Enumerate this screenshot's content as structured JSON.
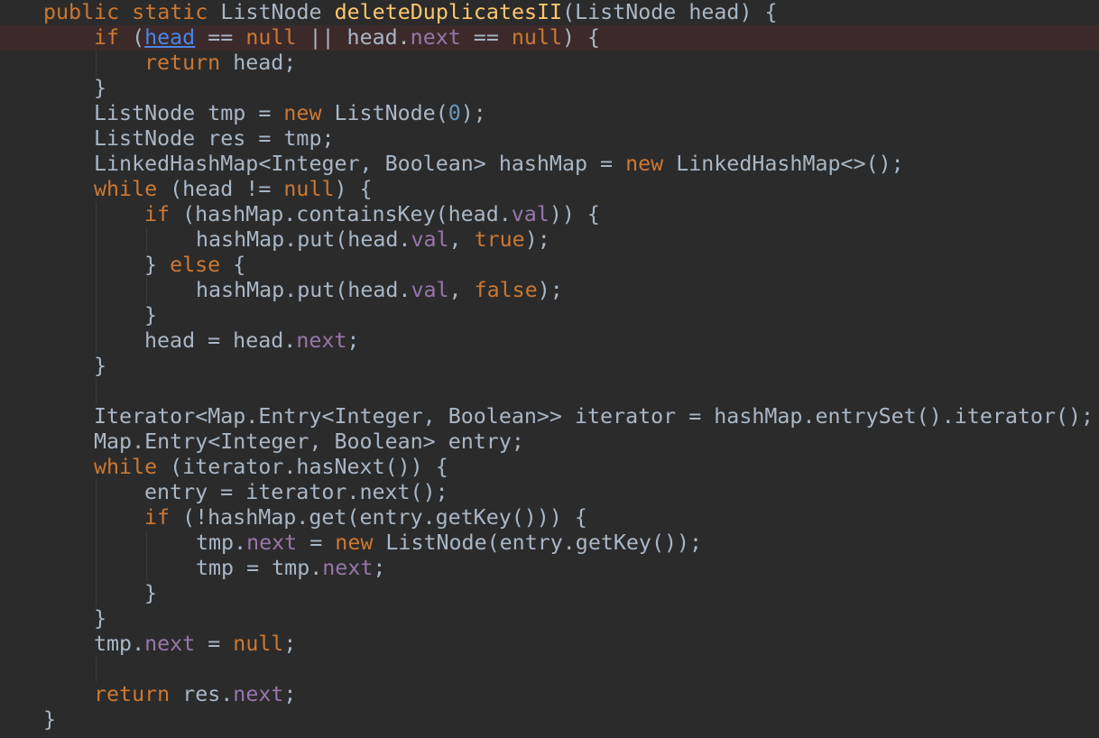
{
  "editor": {
    "language": "Java",
    "theme_colors": {
      "background": "#2b2b2b",
      "highlight_line": "#3c2a2a",
      "keyword": "#cc7832",
      "method_declaration": "#ffc66d",
      "field": "#9876aa",
      "number": "#6897bb",
      "identifier": "#a9b7c6",
      "link": "#4a86e8"
    },
    "lines": [
      {
        "indent": 1,
        "tokens": [
          {
            "t": "public static ",
            "c": "kw"
          },
          {
            "t": "ListNode ",
            "c": "id"
          },
          {
            "t": "deleteDuplicatesII",
            "c": "fn"
          },
          {
            "t": "(ListNode head) {",
            "c": "id"
          }
        ]
      },
      {
        "indent": 2,
        "highlight": true,
        "tokens": [
          {
            "t": "if ",
            "c": "kw"
          },
          {
            "t": "(",
            "c": "id"
          },
          {
            "t": "head",
            "c": "link"
          },
          {
            "t": " == ",
            "c": "id"
          },
          {
            "t": "null",
            "c": "kw"
          },
          {
            "t": " || head.",
            "c": "id"
          },
          {
            "t": "next",
            "c": "fld"
          },
          {
            "t": " == ",
            "c": "id"
          },
          {
            "t": "null",
            "c": "kw"
          },
          {
            "t": ") {",
            "c": "id"
          }
        ]
      },
      {
        "indent": 3,
        "guides": [
          1
        ],
        "tokens": [
          {
            "t": "return ",
            "c": "kw"
          },
          {
            "t": "head;",
            "c": "id"
          }
        ]
      },
      {
        "indent": 2,
        "tokens": [
          {
            "t": "}",
            "c": "id"
          }
        ]
      },
      {
        "indent": 2,
        "tokens": [
          {
            "t": "ListNode tmp = ",
            "c": "id"
          },
          {
            "t": "new ",
            "c": "kw"
          },
          {
            "t": "ListNode(",
            "c": "id"
          },
          {
            "t": "0",
            "c": "num"
          },
          {
            "t": ");",
            "c": "id"
          }
        ]
      },
      {
        "indent": 2,
        "tokens": [
          {
            "t": "ListNode res = tmp;",
            "c": "id"
          }
        ]
      },
      {
        "indent": 2,
        "tokens": [
          {
            "t": "LinkedHashMap<Integer, Boolean> hashMap = ",
            "c": "id"
          },
          {
            "t": "new ",
            "c": "kw"
          },
          {
            "t": "LinkedHashMap<>();",
            "c": "id"
          }
        ]
      },
      {
        "indent": 2,
        "tokens": [
          {
            "t": "while ",
            "c": "kw"
          },
          {
            "t": "(head != ",
            "c": "id"
          },
          {
            "t": "null",
            "c": "kw"
          },
          {
            "t": ") {",
            "c": "id"
          }
        ]
      },
      {
        "indent": 3,
        "guides": [
          1
        ],
        "tokens": [
          {
            "t": "if ",
            "c": "kw"
          },
          {
            "t": "(hashMap.containsKey(head.",
            "c": "id"
          },
          {
            "t": "val",
            "c": "fld"
          },
          {
            "t": ")) {",
            "c": "id"
          }
        ]
      },
      {
        "indent": 4,
        "guides": [
          1,
          2
        ],
        "tokens": [
          {
            "t": "hashMap.put(head.",
            "c": "id"
          },
          {
            "t": "val",
            "c": "fld"
          },
          {
            "t": ", ",
            "c": "id"
          },
          {
            "t": "true",
            "c": "kw"
          },
          {
            "t": ");",
            "c": "id"
          }
        ]
      },
      {
        "indent": 3,
        "guides": [
          1
        ],
        "tokens": [
          {
            "t": "} ",
            "c": "id"
          },
          {
            "t": "else ",
            "c": "kw"
          },
          {
            "t": "{",
            "c": "id"
          }
        ]
      },
      {
        "indent": 4,
        "guides": [
          1,
          2
        ],
        "tokens": [
          {
            "t": "hashMap.put(head.",
            "c": "id"
          },
          {
            "t": "val",
            "c": "fld"
          },
          {
            "t": ", ",
            "c": "id"
          },
          {
            "t": "false",
            "c": "kw"
          },
          {
            "t": ");",
            "c": "id"
          }
        ]
      },
      {
        "indent": 3,
        "guides": [
          1
        ],
        "tokens": [
          {
            "t": "}",
            "c": "id"
          }
        ]
      },
      {
        "indent": 3,
        "guides": [
          1
        ],
        "tokens": [
          {
            "t": "head = head.",
            "c": "id"
          },
          {
            "t": "next",
            "c": "fld"
          },
          {
            "t": ";",
            "c": "id"
          }
        ]
      },
      {
        "indent": 2,
        "tokens": [
          {
            "t": "}",
            "c": "id"
          }
        ]
      },
      {
        "indent": 0,
        "guides": [
          1
        ],
        "tokens": []
      },
      {
        "indent": 2,
        "tokens": [
          {
            "t": "Iterator<Map.Entry<Integer, Boolean>> iterator = hashMap.entrySet().iterator();",
            "c": "id"
          }
        ]
      },
      {
        "indent": 2,
        "tokens": [
          {
            "t": "Map.Entry<Integer, Boolean> entry;",
            "c": "id"
          }
        ]
      },
      {
        "indent": 2,
        "tokens": [
          {
            "t": "while ",
            "c": "kw"
          },
          {
            "t": "(iterator.hasNext()) {",
            "c": "id"
          }
        ]
      },
      {
        "indent": 3,
        "guides": [
          1
        ],
        "tokens": [
          {
            "t": "entry = iterator.next();",
            "c": "id"
          }
        ]
      },
      {
        "indent": 3,
        "guides": [
          1
        ],
        "tokens": [
          {
            "t": "if ",
            "c": "kw"
          },
          {
            "t": "(!hashMap.get(entry.getKey())) {",
            "c": "id"
          }
        ]
      },
      {
        "indent": 4,
        "guides": [
          1,
          2
        ],
        "tokens": [
          {
            "t": "tmp.",
            "c": "id"
          },
          {
            "t": "next",
            "c": "fld"
          },
          {
            "t": " = ",
            "c": "id"
          },
          {
            "t": "new ",
            "c": "kw"
          },
          {
            "t": "ListNode(entry.getKey());",
            "c": "id"
          }
        ]
      },
      {
        "indent": 4,
        "guides": [
          1,
          2
        ],
        "tokens": [
          {
            "t": "tmp = tmp.",
            "c": "id"
          },
          {
            "t": "next",
            "c": "fld"
          },
          {
            "t": ";",
            "c": "id"
          }
        ]
      },
      {
        "indent": 3,
        "guides": [
          1
        ],
        "tokens": [
          {
            "t": "}",
            "c": "id"
          }
        ]
      },
      {
        "indent": 2,
        "tokens": [
          {
            "t": "}",
            "c": "id"
          }
        ]
      },
      {
        "indent": 2,
        "tokens": [
          {
            "t": "tmp.",
            "c": "id"
          },
          {
            "t": "next",
            "c": "fld"
          },
          {
            "t": " = ",
            "c": "id"
          },
          {
            "t": "null",
            "c": "kw"
          },
          {
            "t": ";",
            "c": "id"
          }
        ]
      },
      {
        "indent": 0,
        "guides": [
          1
        ],
        "tokens": []
      },
      {
        "indent": 2,
        "tokens": [
          {
            "t": "return ",
            "c": "kw"
          },
          {
            "t": "res.",
            "c": "id"
          },
          {
            "t": "next",
            "c": "fld"
          },
          {
            "t": ";",
            "c": "id"
          }
        ]
      },
      {
        "indent": 1,
        "tokens": [
          {
            "t": "}",
            "c": "id"
          }
        ]
      }
    ]
  }
}
